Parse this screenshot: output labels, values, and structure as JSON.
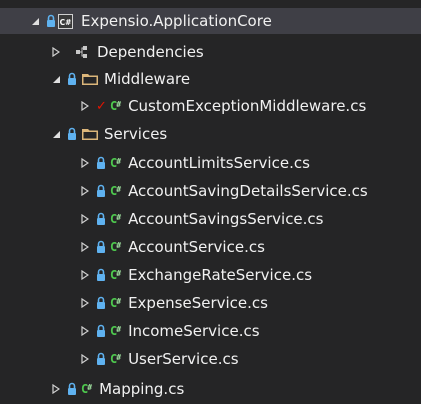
{
  "colors": {
    "background": "#252526",
    "selected_row": "#3f3f46",
    "text": "#f1f1f1",
    "csharp_icon": "#4ec94e",
    "folder_icon": "#dcb67a",
    "lock_icon": "#5fb2f0",
    "check_icon": "#e51400"
  },
  "tree": {
    "project": {
      "label": "Expensio.ApplicationCore",
      "icon": "csharp-project-icon",
      "expanded": true,
      "selected": true
    },
    "dependencies": {
      "label": "Dependencies",
      "icon": "dependencies-icon"
    },
    "middleware": {
      "label": "Middleware",
      "icon": "folder-icon",
      "expanded": true,
      "files": [
        {
          "label": "CustomExceptionMiddleware.cs",
          "status_icon": "pending-edit-check-icon"
        }
      ]
    },
    "services": {
      "label": "Services",
      "icon": "folder-icon",
      "expanded": true,
      "files": [
        {
          "label": "AccountLimitsService.cs",
          "status_icon": "lock-icon"
        },
        {
          "label": "AccountSavingDetailsService.cs",
          "status_icon": "lock-icon"
        },
        {
          "label": "AccountSavingsService.cs",
          "status_icon": "lock-icon"
        },
        {
          "label": "AccountService.cs",
          "status_icon": "lock-icon"
        },
        {
          "label": "ExchangeRateService.cs",
          "status_icon": "lock-icon"
        },
        {
          "label": "ExpenseService.cs",
          "status_icon": "lock-icon"
        },
        {
          "label": "IncomeService.cs",
          "status_icon": "lock-icon"
        },
        {
          "label": "UserService.cs",
          "status_icon": "lock-icon"
        }
      ]
    },
    "mapping": {
      "label": "Mapping.cs",
      "status_icon": "lock-icon"
    }
  }
}
